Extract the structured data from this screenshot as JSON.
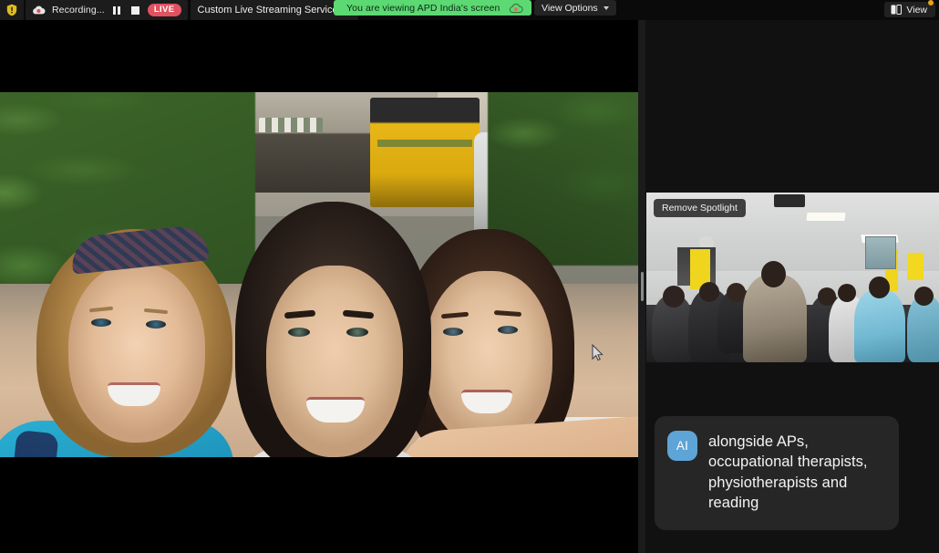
{
  "topbar": {
    "security_icon": "shield-warning-icon",
    "recording": {
      "icon": "cloud-record-icon",
      "label": "Recording...",
      "pause_icon": "pause-icon",
      "stop_icon": "stop-icon",
      "live_badge": "LIVE"
    },
    "streaming_service": {
      "label": "Custom Live Streaming Service",
      "chevron_icon": "chevron-down-icon"
    },
    "viewing_banner": {
      "text": "You are viewing APD India's screen",
      "cloud_icon": "cloud-record-icon",
      "color": "#5cd973"
    },
    "view_options": {
      "label": "View Options",
      "chevron_icon": "chevron-down-icon"
    },
    "view_button": {
      "label": "View",
      "icon": "layout-view-icon",
      "badge_dot_color": "#e8a317"
    }
  },
  "share_stage": {
    "name": "shared-screen",
    "content_description": "Outdoor selfie photograph of three young women smiling, with palm foliage, a yellow bus, a silver car and street shops behind them",
    "background_color": "#000000",
    "cursor_icon": "mouse-pointer-icon"
  },
  "divider": {
    "handle_icon": "drag-handle-icon"
  },
  "right_panel": {
    "video_tile": {
      "spotlight_button_label": "Remove Spotlight",
      "content_description": "Video feed of a classroom full of seated participants, a woman in a saree presenting in the centre"
    },
    "caption": {
      "avatar_label": "AI",
      "avatar_color": "#5ea4d6",
      "text": "alongside APs, occupational therapists, physiotherapists and reading"
    }
  }
}
